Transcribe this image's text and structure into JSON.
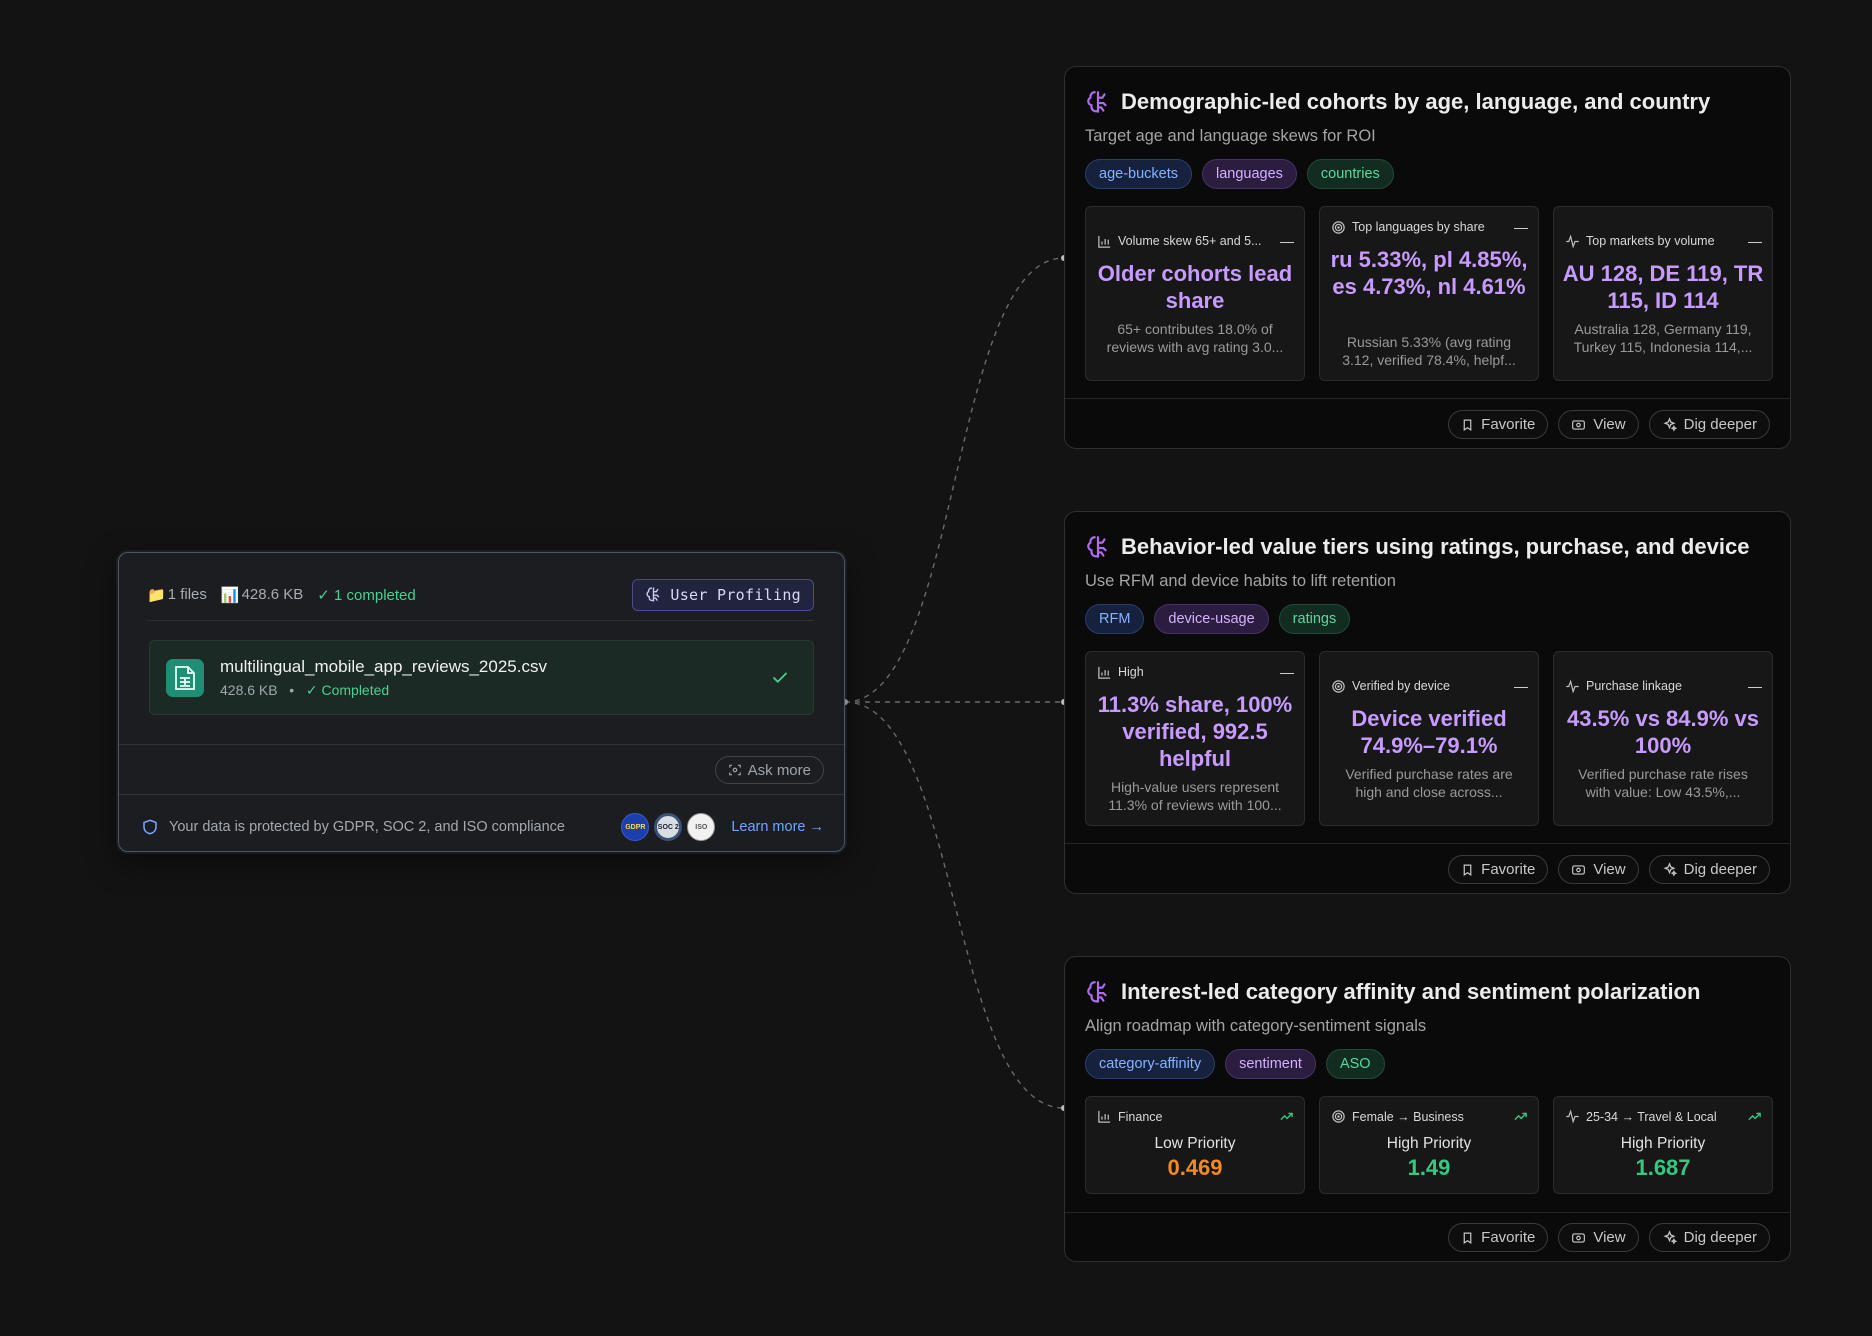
{
  "source": {
    "files_label": "1 files",
    "size_label": "428.6 KB",
    "completed_label": "✓ 1 completed",
    "profiling_badge": "User Profiling",
    "file": {
      "name": "multilingual_mobile_app_reviews_2025.csv",
      "size": "428.6 KB",
      "separator": "•",
      "status": "✓ Completed"
    },
    "ask_more": "Ask more",
    "footer_note": "Your data is protected by GDPR, SOC 2, and ISO compliance",
    "compliance_badges": [
      "GDPR",
      "SOC 2",
      "ISO"
    ],
    "learn_more": "Learn more →"
  },
  "action_labels": {
    "favorite": "Favorite",
    "view": "View",
    "dig": "Dig deeper"
  },
  "insights": [
    {
      "title": "Demographic-led cohorts by age, language, and country",
      "subtitle": "Target age and language skews for ROI",
      "tags": [
        {
          "label": "age-buckets",
          "color": "blue"
        },
        {
          "label": "languages",
          "color": "purple"
        },
        {
          "label": "countries",
          "color": "green"
        }
      ],
      "metrics": [
        {
          "icon": "bar-chart-icon",
          "label": "Volume skew 65+ and 5...",
          "value": "Older cohorts lead share",
          "desc": "65+ contributes 18.0% of reviews with avg rating 3.0..."
        },
        {
          "icon": "target-icon",
          "label": "Top languages by share",
          "value": "ru 5.33%, pl 4.85%, es 4.73%, nl 4.61%",
          "desc": "Russian 5.33% (avg rating 3.12, verified 78.4%, helpf..."
        },
        {
          "icon": "activity-icon",
          "label": "Top markets by volume",
          "value": "AU 128, DE 119, TR 115, ID 114",
          "desc": "Australia 128, Germany 119, Turkey 115, Indonesia 114,..."
        }
      ]
    },
    {
      "title": "Behavior-led value tiers using ratings, purchase, and device",
      "subtitle": "Use RFM and device habits to lift retention",
      "tags": [
        {
          "label": "RFM",
          "color": "blue"
        },
        {
          "label": "device-usage",
          "color": "purple"
        },
        {
          "label": "ratings",
          "color": "green"
        }
      ],
      "metrics": [
        {
          "icon": "bar-chart-icon",
          "label": "High",
          "value": "11.3% share, 100% verified, 992.5 helpful",
          "desc": "High-value users represent 11.3% of reviews with 100..."
        },
        {
          "icon": "target-icon",
          "label": "Verified by device",
          "value": "Device verified 74.9%–79.1%",
          "desc": "Verified purchase rates are high and close across..."
        },
        {
          "icon": "activity-icon",
          "label": "Purchase linkage",
          "value": "43.5% vs 84.9% vs 100%",
          "desc": "Verified purchase rate rises with value: Low 43.5%,..."
        }
      ]
    },
    {
      "title": "Interest-led category affinity and sentiment polarization",
      "subtitle": "Align roadmap with category-sentiment signals",
      "tags": [
        {
          "label": "category-affinity",
          "color": "blue"
        },
        {
          "label": "sentiment",
          "color": "purple"
        },
        {
          "label": "ASO",
          "color": "green"
        }
      ],
      "metrics": [
        {
          "icon": "bar-chart-icon",
          "label": "Finance",
          "priority": "Low Priority",
          "score": "0.469",
          "score_color": "#f08a24"
        },
        {
          "icon": "target-icon",
          "label": "Female → Business",
          "priority": "High Priority",
          "score": "1.49",
          "score_color": "#35c880"
        },
        {
          "icon": "activity-icon",
          "label": "25-34 → Travel & Local",
          "priority": "High Priority",
          "score": "1.687",
          "score_color": "#35c880"
        }
      ]
    }
  ]
}
